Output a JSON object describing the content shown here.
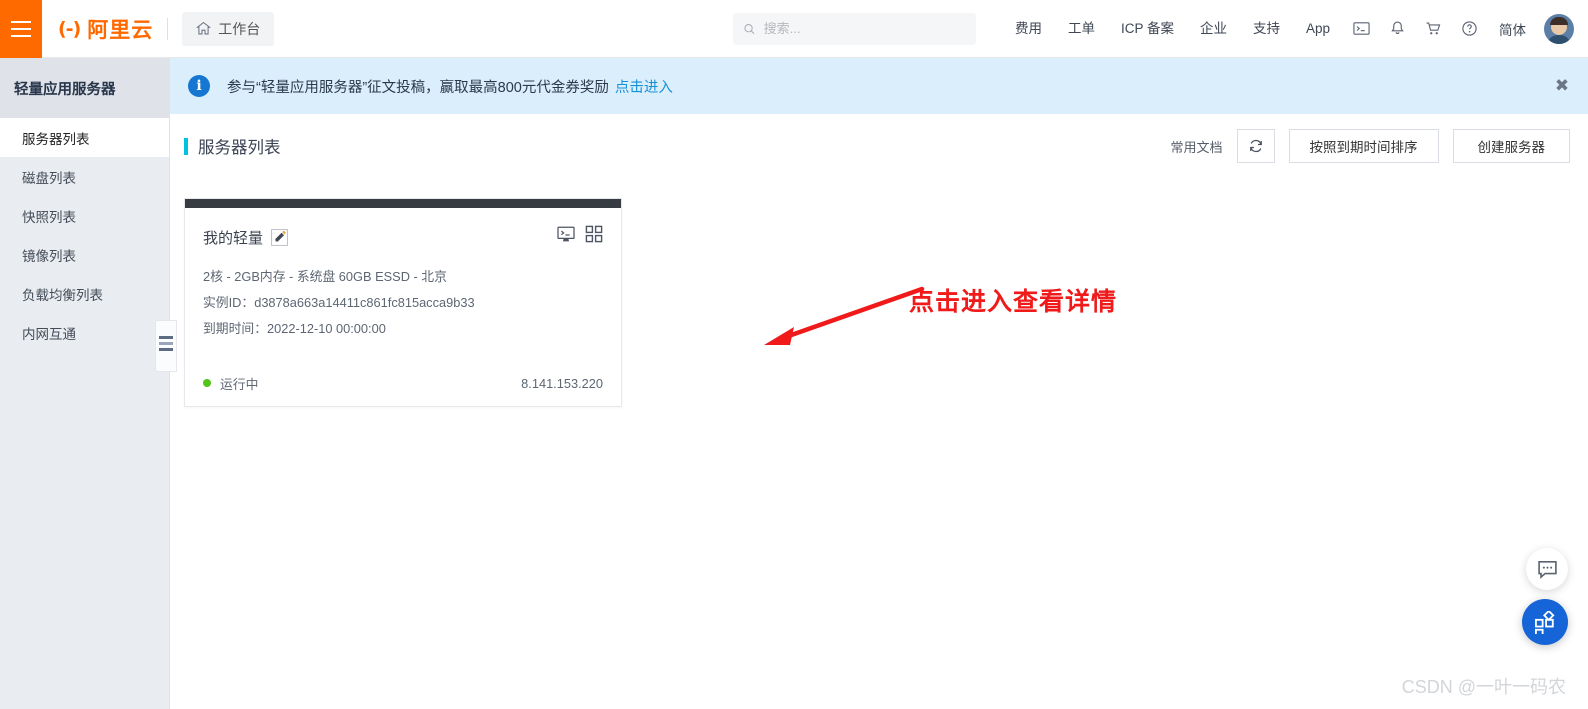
{
  "header": {
    "menu_icon": "hamburger-icon",
    "brand_mark": "(-)",
    "brand_name": "阿里云",
    "workbench_label": "工作台",
    "search": {
      "value": "",
      "placeholder": "搜索..."
    },
    "nav": [
      {
        "label": "费用"
      },
      {
        "label": "工单"
      },
      {
        "label": "ICP 备案"
      },
      {
        "label": "企业"
      },
      {
        "label": "支持"
      },
      {
        "label": "App"
      }
    ],
    "icons": [
      "terminal-icon",
      "bell-icon",
      "cart-icon",
      "help-icon"
    ],
    "language": "简体",
    "avatar": "user-avatar"
  },
  "sidebar": {
    "title": "轻量应用服务器",
    "items": [
      {
        "label": "服务器列表",
        "active": true
      },
      {
        "label": "磁盘列表",
        "active": false
      },
      {
        "label": "快照列表",
        "active": false
      },
      {
        "label": "镜像列表",
        "active": false
      },
      {
        "label": "负载均衡列表",
        "active": false
      },
      {
        "label": "内网互通",
        "active": false
      }
    ],
    "collapse_handle": "sidebar-collapse-handle"
  },
  "banner": {
    "icon": "info-icon",
    "text": "参与“轻量应用服务器”征文投稿，赢取最高800元代金券奖励",
    "link_label": "点击进入",
    "close_label": "✖",
    "bg_color": "#dbeefc",
    "icon_color": "#1677d2",
    "link_color": "#1791d6"
  },
  "page": {
    "title": "服务器列表",
    "title_accent_color": "#00C1DE",
    "doc_link": "常用文档",
    "refresh_icon": "refresh-icon",
    "sort_button": "按照到期时间排序",
    "create_button": "创建服务器"
  },
  "server_card": {
    "name": "我的轻量",
    "edit_icon": "pencil-icon",
    "actions": [
      "remote-connect-icon",
      "apps-grid-icon"
    ],
    "spec": "2核 - 2GB内存 - 系统盘 60GB ESSD - 北京",
    "instance_id_label": "实例ID：",
    "instance_id": "d3878a663a14411c861fc815acca9b33",
    "expire_label": "到期时间：",
    "expire_time": "2022-12-10 00:00:00",
    "status": "运行中",
    "status_color": "#52c41a",
    "ip": "8.141.153.220",
    "top_bar_color": "#373c42"
  },
  "annotation": {
    "text": "点击进入查看详情",
    "color": "#F01A1A",
    "arrow": "red-arrow-pointing-left-down"
  },
  "floating": {
    "chat_icon": "chat-bubble-icon",
    "apps_icon": "apps-grid-icon",
    "apps_color": "#1565D8"
  },
  "watermark": "CSDN @一叶一码农"
}
